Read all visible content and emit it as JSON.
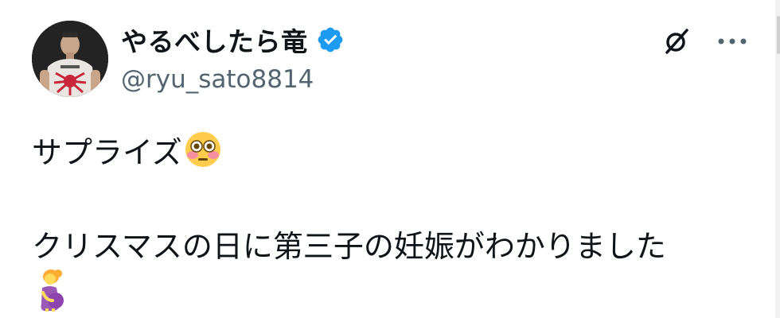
{
  "author": {
    "display_name": "やるべしたら竜",
    "handle": "@ryu_sato8814",
    "verified": true,
    "avatar_icon": "profile-photo"
  },
  "actions": {
    "grok_icon": "grok-icon",
    "more_icon": "more-horizontal-icon"
  },
  "tweet": {
    "line1": "サプライズ",
    "line1_emoji": "flushed-face-emoji",
    "line2": "クリスマスの日に第三子の妊娠がわかりました",
    "line3_emoji": "pregnant-woman-emoji"
  },
  "colors": {
    "text": "#0f1419",
    "secondary_text": "#536471",
    "verified_blue": "#1d9bf0",
    "background": "#ffffff"
  }
}
